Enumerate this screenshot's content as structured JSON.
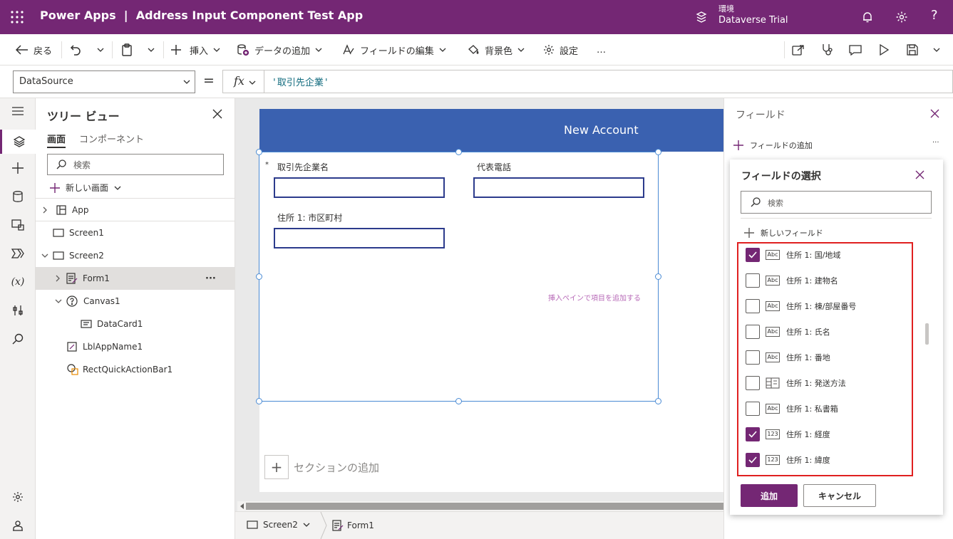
{
  "app": {
    "brand": "Power Apps",
    "separator": "|",
    "title": "Address Input Component Test App",
    "env_label": "環境",
    "env_name": "Dataverse Trial",
    "accent": "#742774"
  },
  "toolbar": {
    "back": "戻る",
    "insert": "挿入",
    "add_data": "データの追加",
    "edit_fields": "フィールドの編集",
    "background": "背景色",
    "settings": "設定",
    "more": "…"
  },
  "formula_bar": {
    "property": "DataSource",
    "equals": "=",
    "fx": "fx",
    "formula": "'取引先企業'"
  },
  "tree": {
    "title": "ツリー ビュー",
    "tab_screens": "画面",
    "tab_components": "コンポーネント",
    "search_placeholder": "検索",
    "new_screen": "新しい画面",
    "items": [
      {
        "label": "App"
      },
      {
        "label": "Screen1"
      },
      {
        "label": "Screen2"
      },
      {
        "label": "Form1"
      },
      {
        "label": "Canvas1"
      },
      {
        "label": "DataCard1"
      },
      {
        "label": "LblAppName1"
      },
      {
        "label": "RectQuickActionBar1"
      }
    ],
    "more": "···"
  },
  "canvas": {
    "header": "New Account",
    "required_mark": "*",
    "field1_label": "取引先企業名",
    "field2_label": "代表電話",
    "field3_label": "住所 1: 市区町村",
    "hint": "挿入ペインで項目を追加する",
    "add_section": "セクションの追加",
    "add_section_plus": "+"
  },
  "breadcrumb": {
    "screen": "Screen2",
    "form": "Form1"
  },
  "fields_panel": {
    "title": "フィールド",
    "add_field": "フィールドの追加",
    "more": "···"
  },
  "field_picker": {
    "title": "フィールドの選択",
    "search_placeholder": "検索",
    "new_field": "新しいフィールド",
    "items": [
      {
        "label": "住所 1: 国/地域",
        "icon": "Abc",
        "checked": true
      },
      {
        "label": "住所 1: 建物名",
        "icon": "Abc",
        "checked": false
      },
      {
        "label": "住所 1: 棟/部屋番号",
        "icon": "Abc",
        "checked": false
      },
      {
        "label": "住所 1: 氏名",
        "icon": "Abc",
        "checked": false
      },
      {
        "label": "住所 1: 番地",
        "icon": "Abc",
        "checked": false
      },
      {
        "label": "住所 1: 発送方法",
        "icon": "choice-grid",
        "checked": false
      },
      {
        "label": "住所 1: 私書箱",
        "icon": "Abc",
        "checked": false
      },
      {
        "label": "住所 1: 経度",
        "icon": "123",
        "checked": true
      },
      {
        "label": "住所 1: 緯度",
        "icon": "123",
        "checked": true
      }
    ],
    "add_button": "追加",
    "cancel_button": "キャンセル",
    "highlight_color": "#e02020"
  }
}
